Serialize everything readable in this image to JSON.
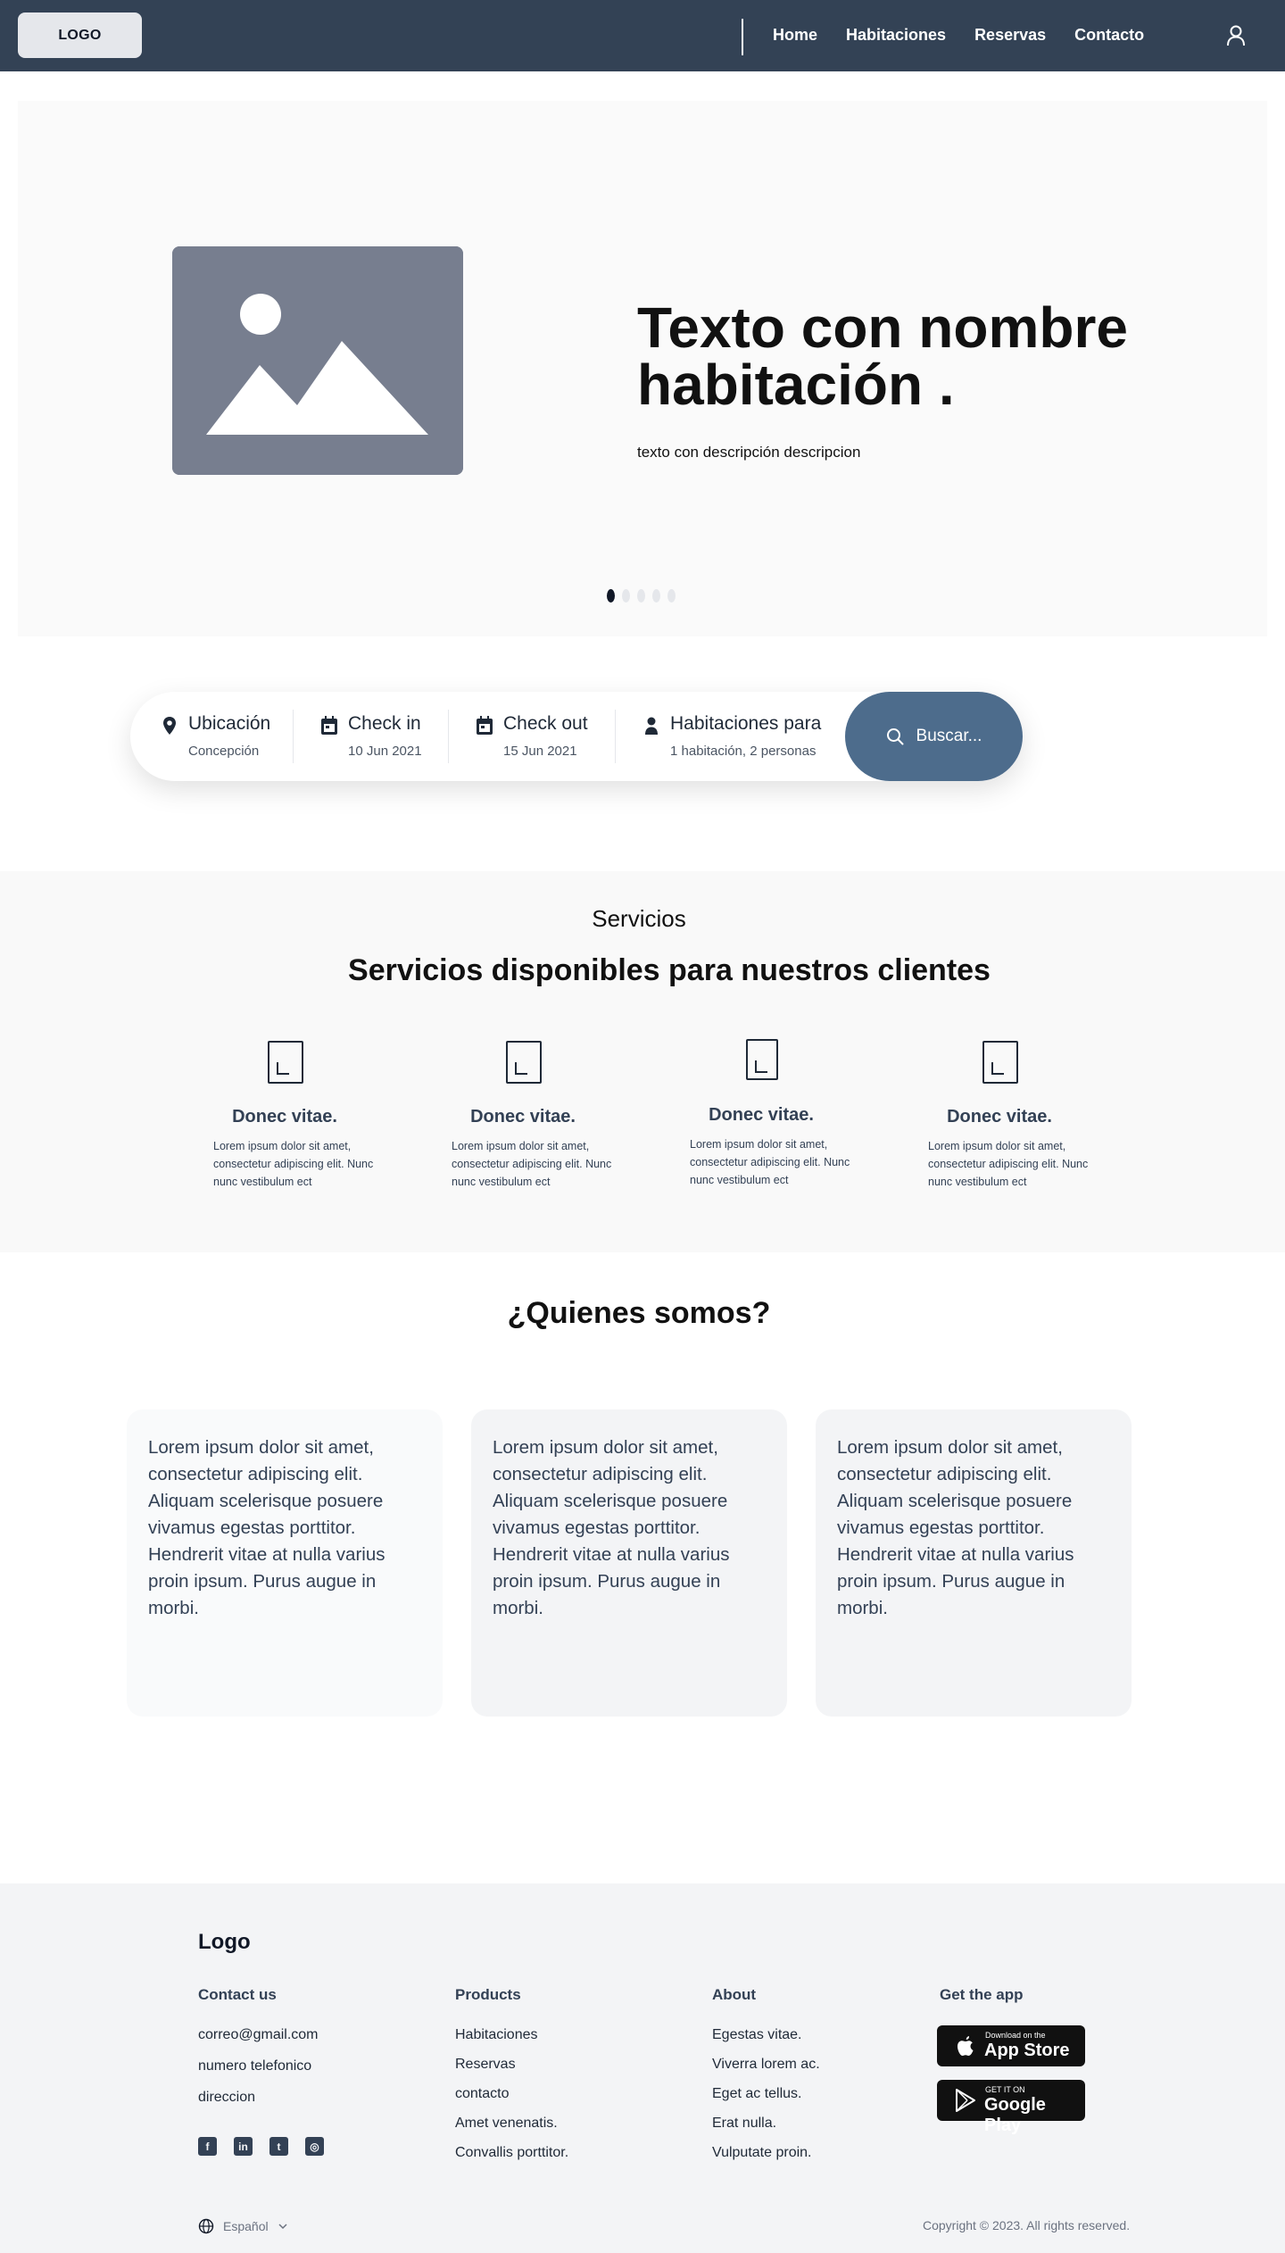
{
  "header": {
    "logo": "LOGO",
    "nav": [
      "Home",
      "Habitaciones",
      "Reservas",
      "Contacto"
    ],
    "user_icon": "user-icon"
  },
  "hero": {
    "image_icon": "image-placeholder-icon",
    "title": "Texto con nombre habitación .",
    "subtitle": "texto con descripción descripcion",
    "carousel": {
      "count": 5,
      "active": 1
    }
  },
  "search": {
    "fields": [
      {
        "label": "Ubicación",
        "value": "Concepción",
        "icon": "map-pin-icon"
      },
      {
        "label": "Check in",
        "value": "10 Jun 2021",
        "icon": "calendar-icon"
      },
      {
        "label": "Check out",
        "value": "15 Jun 2021",
        "icon": "calendar-icon"
      },
      {
        "label": "Habitaciones para",
        "value": "1 habitación, 2 personas",
        "icon": "person-icon"
      }
    ],
    "button": "Buscar...",
    "button_icon": "search-icon"
  },
  "services": {
    "kicker": "Servicios",
    "title": "Servicios disponibles para nuestros clientes",
    "cards": [
      {
        "title": "Donec vitae.",
        "text": "Lorem ipsum dolor sit amet, consectetur adipiscing elit. Nunc nunc vestibulum ect"
      },
      {
        "title": "Donec vitae.",
        "text": "Lorem ipsum dolor sit amet, consectetur adipiscing elit. Nunc nunc vestibulum ect"
      },
      {
        "title": "Donec vitae.",
        "text": "Lorem ipsum dolor sit amet, consectetur adipiscing elit. Nunc nunc vestibulum ect"
      },
      {
        "title": "Donec vitae.",
        "text": "Lorem ipsum dolor sit amet, consectetur adipiscing elit. Nunc nunc vestibulum ect"
      }
    ]
  },
  "about": {
    "title": "¿Quienes somos?",
    "cards": [
      "Lorem ipsum dolor sit amet, consectetur adipiscing elit. Aliquam scelerisque posuere vivamus egestas porttitor. Hendrerit vitae at nulla varius proin ipsum. Purus augue in morbi.",
      "Lorem ipsum dolor sit amet, consectetur adipiscing elit. Aliquam scelerisque posuere vivamus egestas porttitor. Hendrerit vitae at nulla varius proin ipsum. Purus augue in morbi.",
      "Lorem ipsum dolor sit amet, consectetur adipiscing elit. Aliquam scelerisque posuere vivamus egestas porttitor. Hendrerit vitae at nulla varius proin ipsum. Purus augue in morbi."
    ]
  },
  "footer": {
    "logo": "Logo",
    "contact": {
      "heading": "Contact us",
      "items": [
        "correo@gmail.com",
        "numero telefonico",
        "direccion"
      ]
    },
    "products": {
      "heading": "Products",
      "items": [
        "Habitaciones",
        "Reservas",
        "contacto",
        "Amet venenatis.",
        "Convallis porttitor."
      ]
    },
    "about": {
      "heading": "About",
      "items": [
        "Egestas vitae.",
        "Viverra lorem ac.",
        "Eget ac tellus.",
        "Erat nulla.",
        "Vulputate proin."
      ]
    },
    "app": {
      "heading": "Get the app",
      "app_store": {
        "small": "Download on the",
        "big": "App Store"
      },
      "google_play": {
        "small": "GET IT ON",
        "big": "Google Play"
      }
    },
    "social_icons": [
      "facebook-icon",
      "linkedin-icon",
      "twitter-icon",
      "instagram-icon"
    ],
    "language": "Español",
    "copyright": "Copyright © 2023. All rights reserved."
  },
  "colors": {
    "header_bg": "#334255",
    "search_button": "#4d6c8c",
    "image_placeholder": "#777e8f",
    "footer_bg": "#f3f4f6"
  }
}
